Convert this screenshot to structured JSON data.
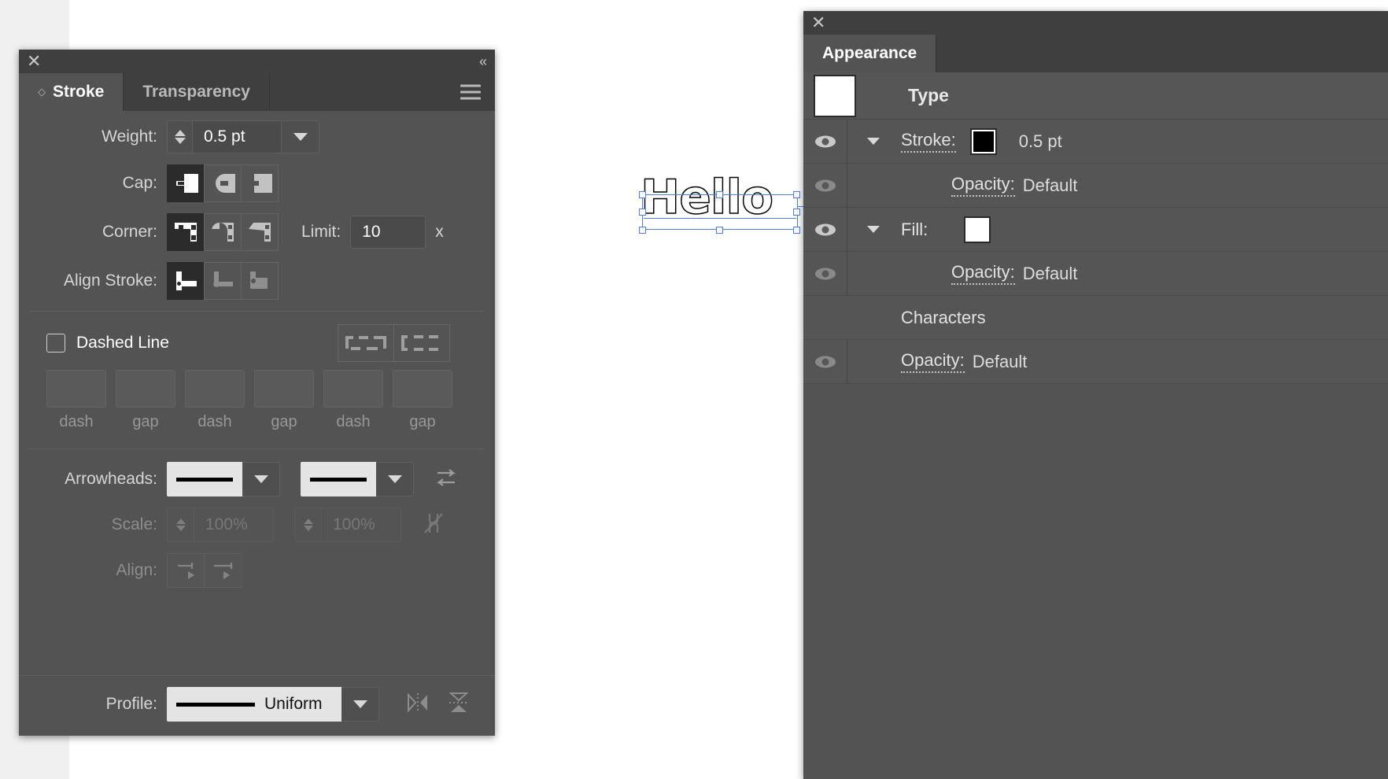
{
  "app": {
    "canvas_artwork_text": "Hello"
  },
  "stroke_panel": {
    "close_icon": "close-icon",
    "collapse_icon": "«",
    "menu_icon": "hamburger-icon",
    "tabs": [
      {
        "label": "Stroke",
        "active": true,
        "has_diamond": true
      },
      {
        "label": "Transparency",
        "active": false,
        "has_diamond": false
      }
    ],
    "weight": {
      "label": "Weight:",
      "value": "0.5 pt"
    },
    "cap": {
      "label": "Cap:",
      "options": [
        "butt-cap-icon",
        "round-cap-icon",
        "projecting-cap-icon"
      ],
      "selected_index": 0
    },
    "corner": {
      "label": "Corner:",
      "options": [
        "miter-join-icon",
        "round-join-icon",
        "bevel-join-icon"
      ],
      "selected_index": 0,
      "limit_label": "Limit:",
      "limit_value": "10",
      "limit_unit": "x"
    },
    "align_stroke": {
      "label": "Align Stroke:",
      "options": [
        "align-center-icon",
        "align-inside-icon",
        "align-outside-icon"
      ],
      "selected_index": 0
    },
    "dashed_line": {
      "label": "Dashed Line",
      "checked": false,
      "presets": [
        "dash-preserve-icon",
        "dash-adjust-icon"
      ],
      "fields": [
        {
          "cap": "dash",
          "value": ""
        },
        {
          "cap": "gap",
          "value": ""
        },
        {
          "cap": "dash",
          "value": ""
        },
        {
          "cap": "gap",
          "value": ""
        },
        {
          "cap": "dash",
          "value": ""
        },
        {
          "cap": "gap",
          "value": ""
        }
      ]
    },
    "arrowheads": {
      "label": "Arrowheads:",
      "start_value": "None",
      "end_value": "None",
      "swap_icon": "swap-arrowheads-icon"
    },
    "scale": {
      "label": "Scale:",
      "start_value": "100%",
      "end_value": "100%",
      "link_icon": "link-broken-icon",
      "disabled": true
    },
    "align_arrowheads": {
      "label": "Align:",
      "options": [
        "extend-beyond-end-icon",
        "place-at-end-icon"
      ],
      "disabled": true
    },
    "profile": {
      "label": "Profile:",
      "value": "Uniform",
      "flip_across_icon": "flip-across-icon",
      "flip_along_icon": "flip-along-icon"
    }
  },
  "appearance_panel": {
    "close_icon": "close-icon",
    "tabs": [
      {
        "label": "Appearance",
        "active": true
      }
    ],
    "target_label": "Type",
    "rows": [
      {
        "kind": "header",
        "label": "Type",
        "has_swatch": true,
        "swatch_color": "#ffffff"
      },
      {
        "kind": "stroke",
        "eye": true,
        "eye_dim": false,
        "twisty": true,
        "label": "Stroke:",
        "underlined": true,
        "swatch_color": "#000000",
        "value": "0.5 pt"
      },
      {
        "kind": "opacity",
        "eye": true,
        "eye_dim": true,
        "twisty": false,
        "label": "Opacity:",
        "underlined": true,
        "value": "Default"
      },
      {
        "kind": "fill",
        "eye": true,
        "eye_dim": false,
        "twisty": true,
        "label": "Fill:",
        "underlined": false,
        "swatch_color": "#ffffff",
        "value": ""
      },
      {
        "kind": "opacity",
        "eye": true,
        "eye_dim": true,
        "twisty": false,
        "label": "Opacity:",
        "underlined": true,
        "value": "Default"
      },
      {
        "kind": "characters",
        "eye": false,
        "twisty": false,
        "label": "Characters",
        "underlined": false,
        "value": ""
      },
      {
        "kind": "opacity",
        "eye": true,
        "eye_dim": true,
        "twisty": false,
        "label": "Opacity:",
        "underlined": true,
        "value": "Default"
      }
    ]
  },
  "colors": {
    "panel_bg": "#535353",
    "panel_header_bg": "#3f3f3f",
    "selection_blue": "#4a7dfc",
    "active_button_bg": "#2b2b2b",
    "text_primary": "#ffffff",
    "text_secondary": "#d6d6d6",
    "text_dim": "#8d8d8d"
  }
}
